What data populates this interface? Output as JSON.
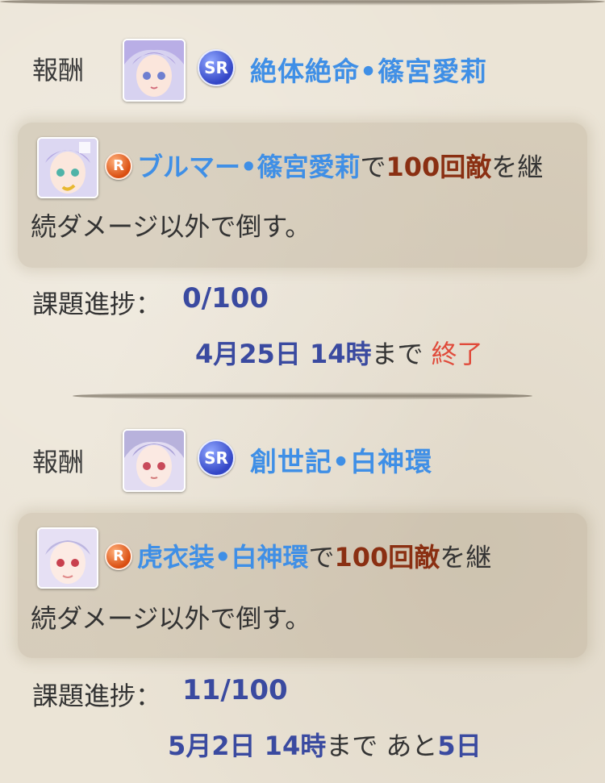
{
  "missions": [
    {
      "reward": {
        "label": "報酬",
        "rarity": "SR",
        "name": "絶体絶命•篠宮愛莉"
      },
      "task": {
        "rarity": "R",
        "character": "ブルマー•篠宮愛莉",
        "particle": "で",
        "count": "100回敵",
        "suffix": "を継",
        "line2": "続ダメージ以外で倒す。"
      },
      "progress": {
        "label": "課題進捗：",
        "value": "0/100"
      },
      "deadline": {
        "date": "4月25日 14時",
        "made": "まで",
        "status": "終了"
      }
    },
    {
      "reward": {
        "label": "報酬",
        "rarity": "SR",
        "name": "創世記•白神環"
      },
      "task": {
        "rarity": "R",
        "character": "虎衣装•白神環",
        "particle": "で",
        "count": "100回敵",
        "suffix": "を継",
        "line2": "続ダメージ以外で倒す。"
      },
      "progress": {
        "label": "課題進捗：",
        "value": "11/100"
      },
      "deadline": {
        "date": "5月2日 14時",
        "made": "まで",
        "remaining_prefix": "あと",
        "remaining_days": "5日"
      }
    }
  ],
  "colors": {
    "reward_name": "#3f8fe6",
    "count": "#8a2f12",
    "progress_value": "#3a4aa0",
    "ended": "#e04a3a",
    "background": "#ebe4d6"
  }
}
